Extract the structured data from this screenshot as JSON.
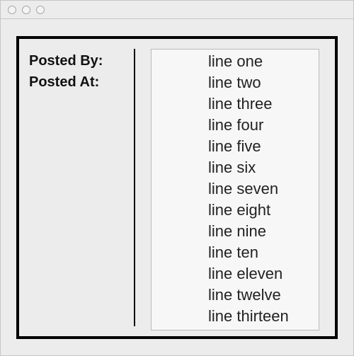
{
  "labels": {
    "posted_by": "Posted By:",
    "posted_at": "Posted At:"
  },
  "lines": [
    "line one",
    "line two",
    "line three",
    "line four",
    "line five",
    "line six",
    "line seven",
    "line eight",
    "line nine",
    "line ten",
    "line eleven",
    "line twelve",
    "line thirteen"
  ]
}
